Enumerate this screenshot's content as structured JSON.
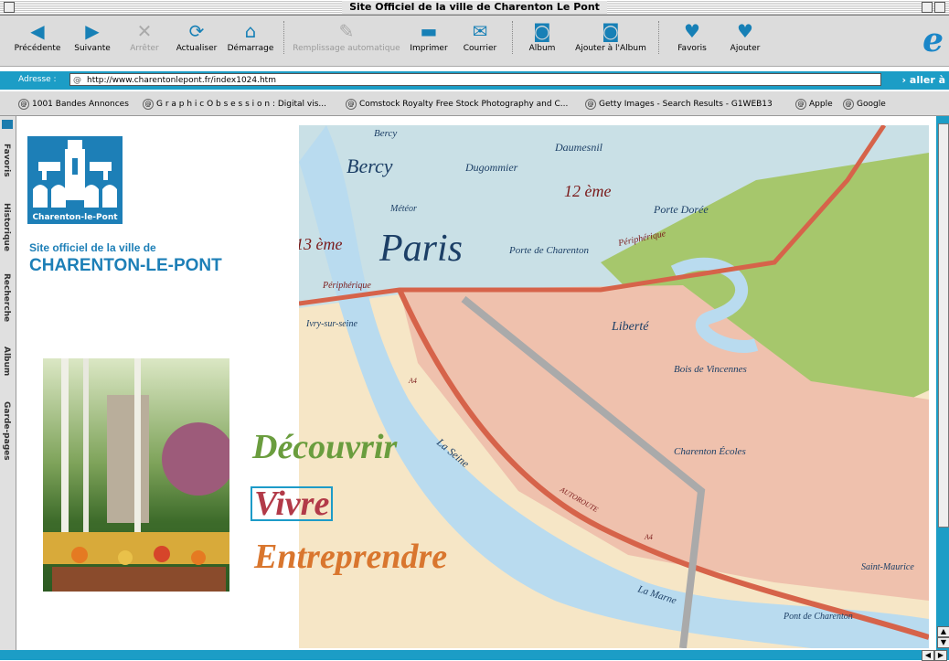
{
  "window": {
    "title": "Site Officiel de la ville de Charenton Le Pont"
  },
  "toolbar": {
    "buttons": [
      {
        "label": "Précédente",
        "icon": "back-arrow-icon"
      },
      {
        "label": "Suivante",
        "icon": "forward-arrow-icon"
      },
      {
        "label": "Arrêter",
        "icon": "stop-icon"
      },
      {
        "label": "Actualiser",
        "icon": "refresh-icon"
      },
      {
        "label": "Démarrage",
        "icon": "home-icon"
      },
      {
        "label": "Remplissage automatique",
        "icon": "autofill-icon"
      },
      {
        "label": "Imprimer",
        "icon": "printer-icon"
      },
      {
        "label": "Courrier",
        "icon": "mail-icon"
      },
      {
        "label": "Album",
        "icon": "camera-icon"
      },
      {
        "label": "Ajouter à l'Album",
        "icon": "camera-add-icon"
      },
      {
        "label": "Favoris",
        "icon": "heart-icon"
      },
      {
        "label": "Ajouter",
        "icon": "heart-add-icon"
      }
    ]
  },
  "address": {
    "label": "Adresse :",
    "url": "http://www.charentonlepont.fr/index1024.htm",
    "go_label": "› aller à"
  },
  "favorites": [
    "1001 Bandes Annonces",
    "G r a p h i c O b s e s s i o n : Digital vis...",
    "Comstock Royalty Free Stock Photography and C...",
    "Getty Images - Search Results - G1WEB13",
    "Apple",
    "Google"
  ],
  "sidebar_tabs": [
    "Favoris",
    "Historique",
    "Recherche",
    "Album",
    "Garde-pages"
  ],
  "page": {
    "logo_text": "Charenton-le-Pont",
    "subtitle": "Site officiel de la ville de",
    "title": "CHARENTON-LE-PONT",
    "links": {
      "discover": "Découvrir",
      "live": "Vivre",
      "business": "Entreprendre"
    }
  },
  "map": {
    "labels": {
      "bercy_small": "Bercy",
      "bercy": "Bercy",
      "dugommier": "Dugommier",
      "daumesnil": "Daumesnil",
      "meteor": "Météor",
      "arr12": "12 ème",
      "porte_doree": "Porte Dorée",
      "arr13": "13 ème",
      "paris": "Paris",
      "porte_charenton": "Porte de Charenton",
      "periph_right": "Périphérique",
      "periph_left": "Périphérique",
      "ivry": "Ivry-sur-seine",
      "liberte": "Liberté",
      "bois": "Bois de Vincennes",
      "seine": "La Seine",
      "charenton_ecoles": "Charenton Écoles",
      "autoroute": "AUTOROUTE",
      "a4": "A4",
      "a4b": "A4",
      "marne": "La Marne",
      "saint_maurice": "Saint-Maurice",
      "pont_charenton": "Pont de Charenton"
    }
  }
}
